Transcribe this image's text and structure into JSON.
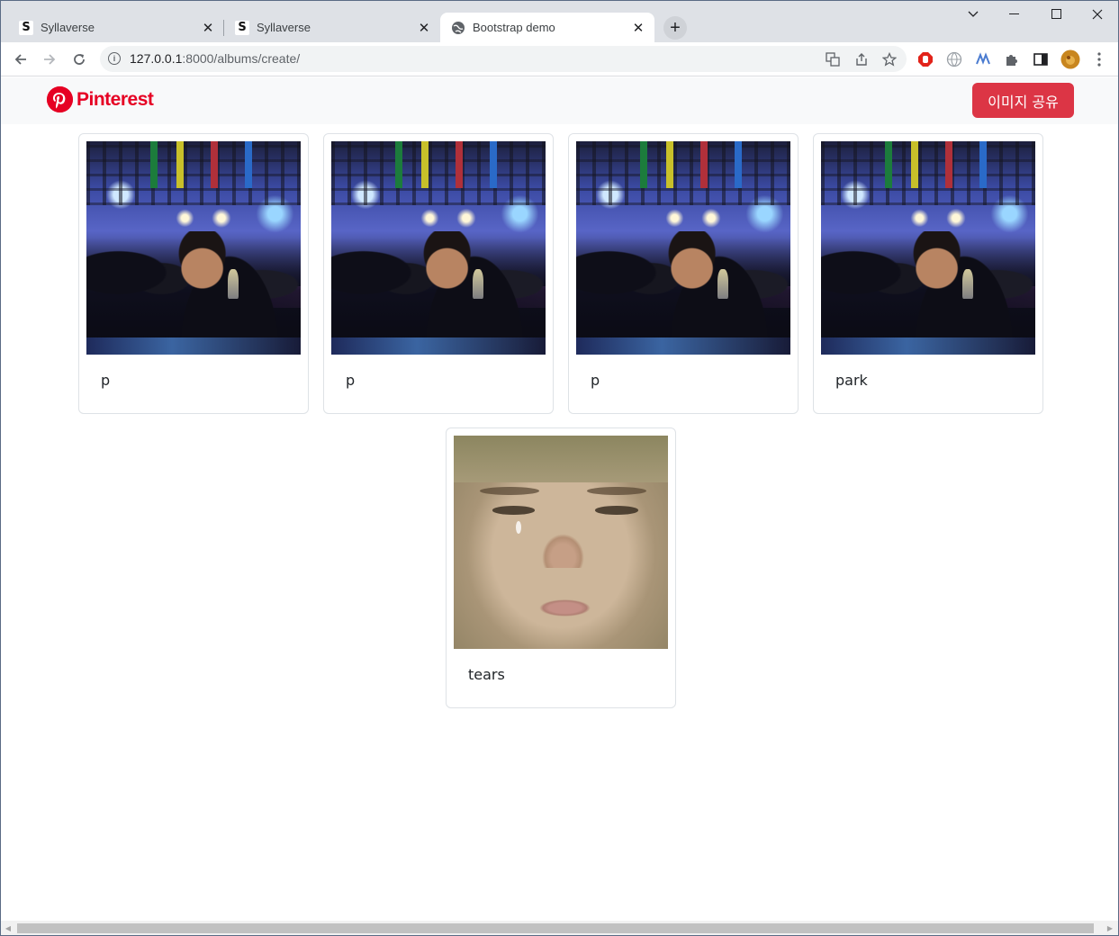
{
  "browser": {
    "tabs": [
      {
        "title": "Syllaverse",
        "favicon": "S",
        "active": false
      },
      {
        "title": "Syllaverse",
        "favicon": "S",
        "active": false
      },
      {
        "title": "Bootstrap demo",
        "favicon": "globe-icon",
        "active": true
      }
    ],
    "new_tab_glyph": "+",
    "close_glyph": "✕",
    "url_host": "127.0.0.1",
    "url_rest": ":8000/albums/create/"
  },
  "navbar": {
    "brand_name": "Pinterest",
    "share_button": "이미지 공유",
    "brand_color": "#e60023",
    "button_color": "#dc3545"
  },
  "albums": [
    {
      "caption": "p",
      "image": "club-photo"
    },
    {
      "caption": "p",
      "image": "club-photo"
    },
    {
      "caption": "p",
      "image": "club-photo"
    },
    {
      "caption": "park",
      "image": "club-photo"
    },
    {
      "caption": "tears",
      "image": "crying-face-photo"
    }
  ]
}
